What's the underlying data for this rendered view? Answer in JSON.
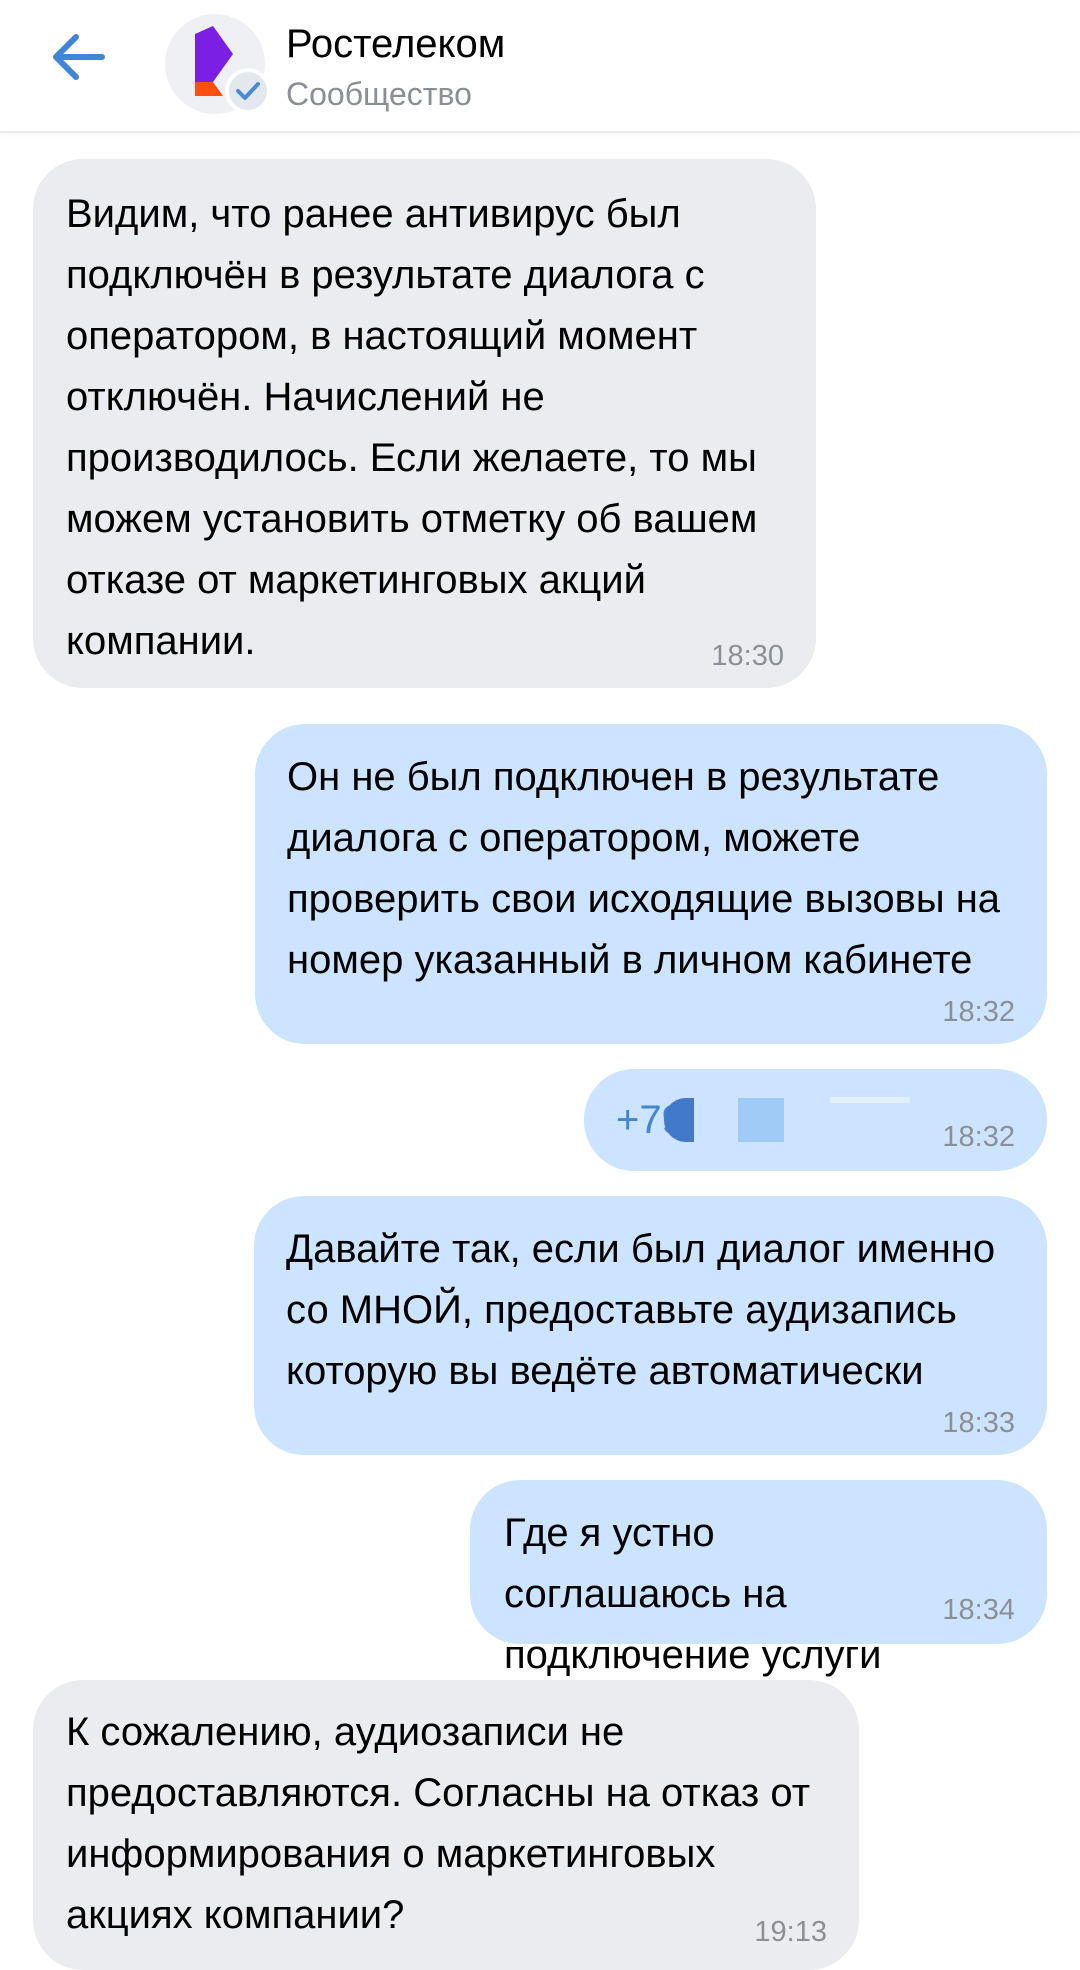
{
  "header": {
    "title": "Ростелеком",
    "subtitle": "Сообщество",
    "back_icon": "arrow-left-icon",
    "avatar_icon": "rostelecom-logo-icon",
    "verified_icon": "checkmark-icon",
    "accent_color": "#3f86d6"
  },
  "messages": [
    {
      "direction": "incoming",
      "text": "Видим, что ранее антивирус был подключён в результате диалога с оператором, в настоящий момент отключён. Начислений не производилось. Если желаете, то мы можем установить отметку об вашем отказе от маркетинговых акций компании.",
      "time": "18:30"
    },
    {
      "direction": "outgoing",
      "text": "Он не был подключен в результате диалога с оператором, можете проверить свои исходящие вызовы на номер указанный в личном кабинете",
      "time": "18:32"
    },
    {
      "direction": "outgoing",
      "text": "+79",
      "time": "18:32"
    },
    {
      "direction": "outgoing",
      "text": "Давайте так, если был диалог именно со МНОЙ, предоставьте аудизапись которую вы ведёте автоматически",
      "time": "18:33"
    },
    {
      "direction": "outgoing",
      "text": "Где я устно соглашаюсь на подключение услуги",
      "time": "18:34"
    },
    {
      "direction": "incoming",
      "text": "К сожалению, аудиозаписи не предоставляются. Согласны на отказ от информирования о маркетинговых акциях компании?",
      "time": "19:13"
    }
  ]
}
